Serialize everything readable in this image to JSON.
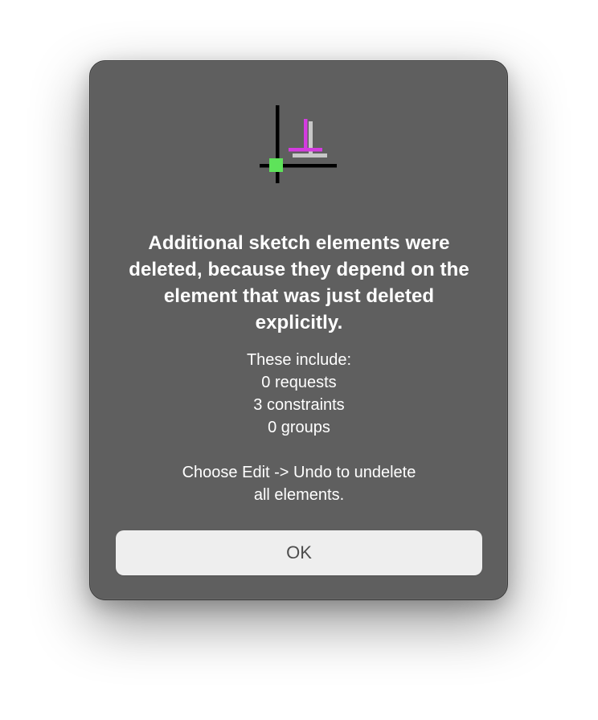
{
  "dialog": {
    "icon": {
      "name": "sketch-constraint-icon",
      "colors": {
        "axes": "#000000",
        "origin_point": "#5ee35a",
        "magenta_element": "#d43be0",
        "gray_element": "#c7c7c7"
      }
    },
    "headline": "Additional sketch elements were deleted, because they depend on the element that was just deleted explicitly.",
    "details": {
      "intro": "These include:",
      "requests": "0 requests",
      "constraints": "3 constraints",
      "groups": "0 groups",
      "hint_line1": "Choose Edit -> Undo to undelete",
      "hint_line2": "all elements."
    },
    "ok_label": "OK",
    "colors": {
      "background": "#5f5f5f",
      "text": "#ffffff",
      "button_background": "#eeeeee",
      "button_text": "#4d4d4d"
    }
  }
}
